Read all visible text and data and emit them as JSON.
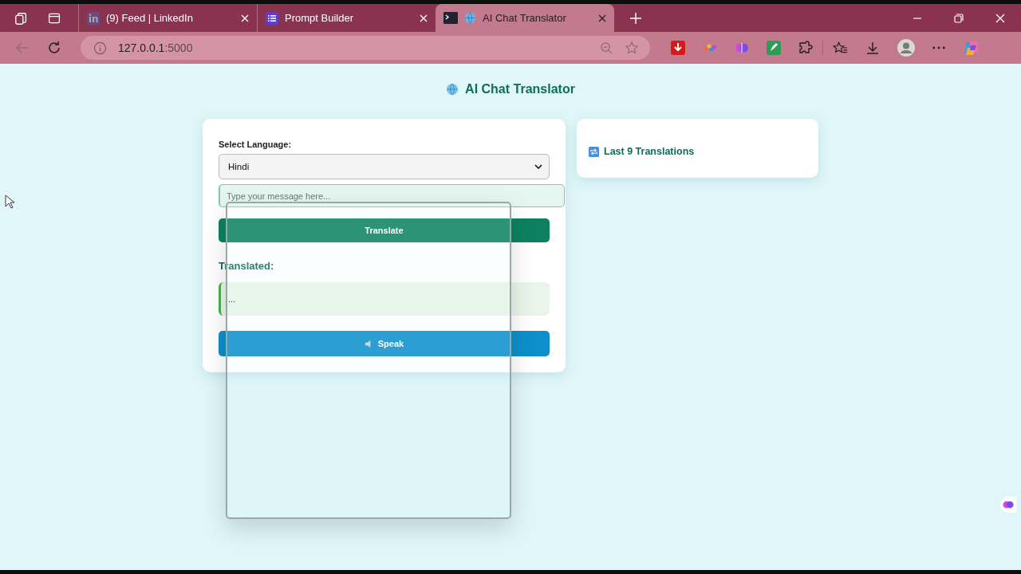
{
  "browser": {
    "tabs": [
      {
        "title": "(9) Feed | LinkedIn",
        "kind": "linkedin",
        "selected": false
      },
      {
        "title": "Prompt Builder",
        "kind": "list",
        "selected": false
      },
      {
        "title": "AI Chat Translator",
        "kind": "globe",
        "selected": true
      }
    ],
    "address_host": "127.0.0.1",
    "address_port": ":5000"
  },
  "page": {
    "title": "AI Chat Translator",
    "form": {
      "language_label": "Select Language:",
      "language": "Hindi",
      "message_placeholder": "Type your message here...",
      "translate_button": "Translate",
      "result_label": "Translated:",
      "result": "...",
      "speak_button": "Speak"
    },
    "history": {
      "title": "Last 9 Translations"
    }
  }
}
